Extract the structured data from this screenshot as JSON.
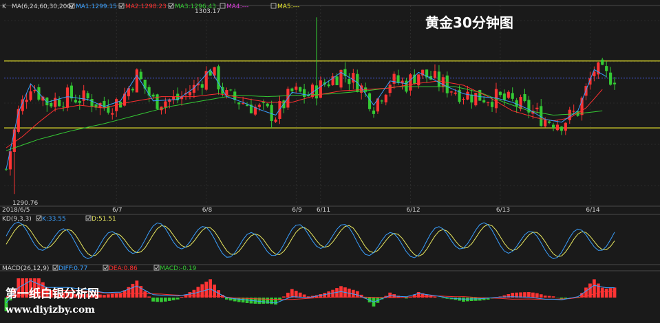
{
  "chart_data": {
    "type": "candlestick",
    "title": "黄金30分钟图",
    "price_panel": {
      "header_prefix": "K",
      "ma_params": "MA(6,24,60,30,200)",
      "ma_legend": [
        {
          "label": "MA1:1299.15",
          "color": "#3aa0ff"
        },
        {
          "label": "MA2:1298.23",
          "color": "#ff3030"
        },
        {
          "label": "MA3:1296.43",
          "color": "#34c934"
        },
        {
          "label": "MA4:---",
          "color": "#e040e0"
        },
        {
          "label": "MA5:---",
          "color": "#e8e830"
        }
      ],
      "high_label": "1303.17",
      "low_label": "1290.76",
      "ylim": [
        1290.0,
        1304.0
      ],
      "support_line": 1295.4,
      "resistance_line": 1300.1,
      "last_price_line": 1298.9,
      "bars_per_day_approx": 22,
      "x_ticks": [
        "2018/6/5",
        "6/7",
        "6/8",
        "6/9",
        "6/11",
        "6/12",
        "6/13",
        "6/14"
      ],
      "x_tick_index": [
        0,
        27,
        49,
        71,
        77,
        99,
        121,
        143
      ],
      "ma1_path": [
        [
          0,
          1292.5
        ],
        [
          3,
          1296.5
        ],
        [
          6,
          1298.5
        ],
        [
          10,
          1297.2
        ],
        [
          15,
          1297.6
        ],
        [
          20,
          1297.4
        ],
        [
          24,
          1296.9
        ],
        [
          28,
          1297.3
        ],
        [
          32,
          1299.1
        ],
        [
          36,
          1297.3
        ],
        [
          42,
          1297.4
        ],
        [
          46,
          1298.2
        ],
        [
          50,
          1299.5
        ],
        [
          54,
          1297.6
        ],
        [
          58,
          1297.2
        ],
        [
          62,
          1296.7
        ],
        [
          66,
          1296.3
        ],
        [
          70,
          1297.9
        ],
        [
          74,
          1297.7
        ],
        [
          78,
          1298.5
        ],
        [
          82,
          1299.3
        ],
        [
          86,
          1298.6
        ],
        [
          90,
          1297.0
        ],
        [
          94,
          1298.7
        ],
        [
          98,
          1298.5
        ],
        [
          101,
          1299.3
        ],
        [
          104,
          1298.9
        ],
        [
          108,
          1298.3
        ],
        [
          112,
          1297.8
        ],
        [
          116,
          1297.6
        ],
        [
          120,
          1297.5
        ],
        [
          124,
          1297.2
        ],
        [
          128,
          1296.7
        ],
        [
          132,
          1296.0
        ],
        [
          136,
          1295.8
        ],
        [
          140,
          1296.6
        ],
        [
          144,
          1299.5
        ],
        [
          147,
          1299.0
        ]
      ],
      "ma2_path": [
        [
          0,
          1294.0
        ],
        [
          4,
          1294.8
        ],
        [
          8,
          1295.8
        ],
        [
          12,
          1296.7
        ],
        [
          18,
          1297.0
        ],
        [
          24,
          1296.8
        ],
        [
          30,
          1297.2
        ],
        [
          38,
          1297.6
        ],
        [
          46,
          1297.6
        ],
        [
          52,
          1297.8
        ],
        [
          58,
          1297.5
        ],
        [
          64,
          1297.2
        ],
        [
          70,
          1297.2
        ],
        [
          76,
          1297.7
        ],
        [
          82,
          1298.0
        ],
        [
          88,
          1298.1
        ],
        [
          94,
          1298.2
        ],
        [
          100,
          1298.5
        ],
        [
          106,
          1298.7
        ],
        [
          112,
          1298.4
        ],
        [
          118,
          1297.6
        ],
        [
          124,
          1296.6
        ],
        [
          130,
          1296.1
        ],
        [
          134,
          1295.9
        ],
        [
          138,
          1296.1
        ],
        [
          142,
          1296.8
        ],
        [
          146,
          1298.1
        ]
      ],
      "ma3_path": [
        [
          0,
          1293.8
        ],
        [
          8,
          1294.6
        ],
        [
          16,
          1295.2
        ],
        [
          24,
          1295.7
        ],
        [
          32,
          1296.3
        ],
        [
          40,
          1296.9
        ],
        [
          48,
          1297.3
        ],
        [
          56,
          1297.7
        ],
        [
          64,
          1297.6
        ],
        [
          72,
          1297.7
        ],
        [
          80,
          1297.8
        ],
        [
          88,
          1298.0
        ],
        [
          96,
          1298.3
        ],
        [
          102,
          1298.3
        ],
        [
          110,
          1298.3
        ],
        [
          116,
          1297.9
        ],
        [
          122,
          1297.2
        ],
        [
          128,
          1296.6
        ],
        [
          134,
          1296.3
        ],
        [
          140,
          1296.4
        ],
        [
          146,
          1296.6
        ]
      ]
    },
    "kd_panel": {
      "params": "KD(9,3,3)",
      "k_label": "K:33.55",
      "d_label": "D:51.51",
      "k_color": "#3aa0ff",
      "d_color": "#e8e860"
    },
    "macd_panel": {
      "params": "MACD(26,12,9)",
      "diff_label": "DIFF:0.77",
      "dea_label": "DEA:0.86",
      "macd_label": "MACD:-0.19",
      "diff_color": "#3aa0ff",
      "dea_color": "#ff3030",
      "macd_color": "#34c934"
    },
    "colors": {
      "up": "#ff3434",
      "down": "#34c934",
      "support_resistance": "#e6e22a",
      "last_price": "#4a5ef0",
      "grid": "#3a3a3a",
      "separator": "#5a5a5a"
    }
  },
  "watermark": {
    "line1": "第一纸白银分析网",
    "line2": "www.diyizby.com"
  }
}
